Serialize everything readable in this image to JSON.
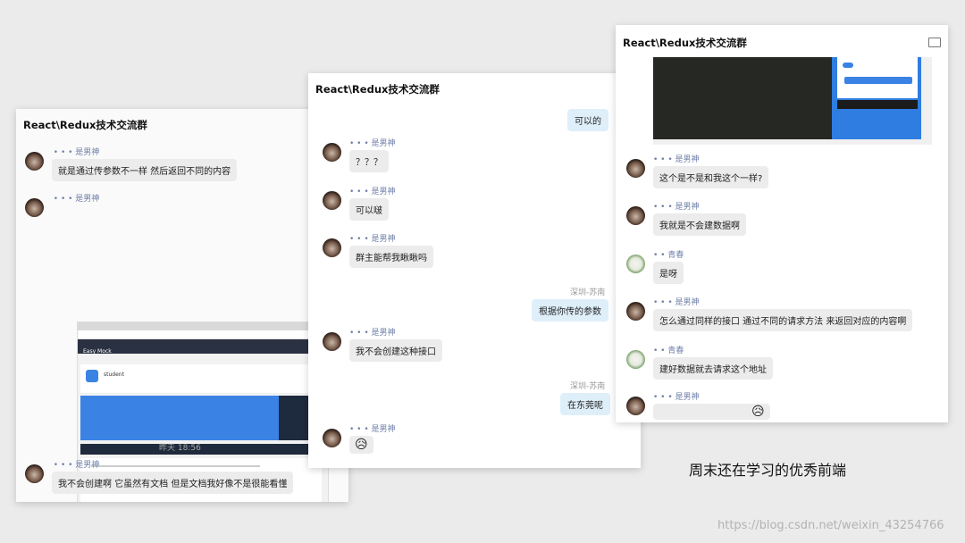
{
  "chat_title": "React\\Redux技术交流群",
  "panel1": {
    "messages": [
      {
        "sender": " • • • 是男神",
        "text": "就是通过传参数不一样 然后返回不同的内容"
      },
      {
        "sender": " • • • 是男神",
        "text": ""
      },
      {
        "sender": " • • • 是男神",
        "text": "我不会创建啊 它虽然有文档 但是文档我好像不是很能看懂"
      }
    ],
    "time": "昨天  18:56",
    "screenshot": {
      "app_name": "Easy Mock",
      "label": "student"
    }
  },
  "panel2": {
    "self_top": "可以的",
    "messages": [
      {
        "sender": "• • • 是男神",
        "text": "？？？"
      },
      {
        "sender": "• • • 是男神",
        "text": "可以啵"
      },
      {
        "sender": "• • • 是男神",
        "text": "群主能帮我瞅瞅吗"
      },
      {
        "sender": "• • • 是男神",
        "text": "我不会创建这种接口"
      },
      {
        "sender": "• • • 是男神",
        "text": "😥"
      }
    ],
    "self_name": "深圳-苏南",
    "self_msgs": [
      "根据你传的参数",
      "在东莞呢"
    ]
  },
  "panel3": {
    "messages": [
      {
        "sender": "• • • 是男神",
        "text": "这个是不是和我这个一样?"
      },
      {
        "sender": "• • • 是男神",
        "text": "我就是不会建数据啊"
      },
      {
        "sender": "• • 青春",
        "text": "是呀"
      },
      {
        "sender": "• • • 是男神",
        "text": "怎么通过同样的接口 通过不同的请求方法 来返回对应的内容啊"
      },
      {
        "sender": "• • 青春",
        "text": "建好数据就去请求这个地址"
      },
      {
        "sender": "• • • 是男神",
        "text": "😥"
      }
    ]
  },
  "caption": "周末还在学习的优秀前端",
  "watermark": "https://blog.csdn.net/weixin_43254766"
}
